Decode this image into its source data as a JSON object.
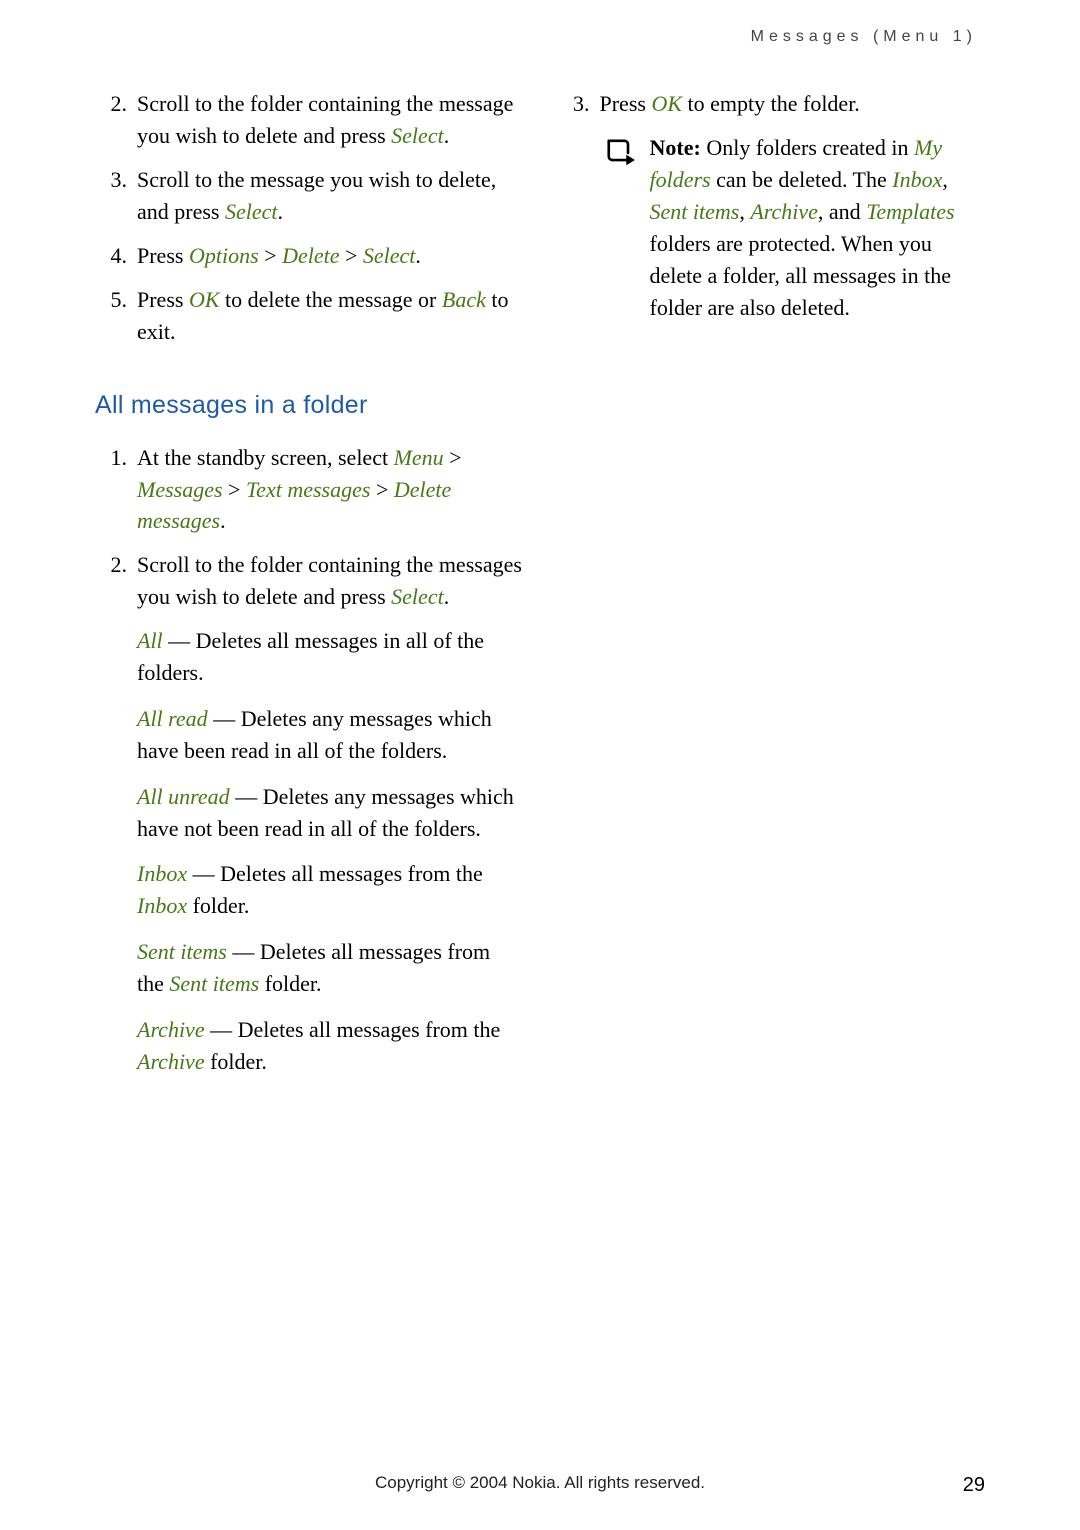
{
  "header": "Messages (Menu 1)",
  "left": {
    "topList": [
      {
        "n": "2.",
        "parts": [
          "Scroll to the folder containing the message you wish to delete and press ",
          {
            "g": "Select"
          },
          "."
        ]
      },
      {
        "n": "3.",
        "parts": [
          "Scroll to the message you wish to delete, and press ",
          {
            "g": "Select"
          },
          "."
        ]
      },
      {
        "n": "4.",
        "parts": [
          "Press ",
          {
            "g": "Options"
          },
          " > ",
          {
            "g": "Delete"
          },
          " > ",
          {
            "g": "Select"
          },
          "."
        ]
      },
      {
        "n": "5.",
        "parts": [
          "Press ",
          {
            "g": "OK"
          },
          " to delete the message or ",
          {
            "g": "Back"
          },
          " to exit."
        ]
      }
    ],
    "sectionTitle": "All messages in a folder",
    "secList": [
      {
        "n": "1.",
        "parts": [
          "At the standby screen, select ",
          {
            "g": "Menu"
          },
          " > ",
          {
            "g": "Messages"
          },
          " > ",
          {
            "g": "Text messages"
          },
          " > ",
          {
            "g": "Delete messages"
          },
          "."
        ]
      },
      {
        "n": "2.",
        "parts": [
          "Scroll to the folder containing the messages you wish to delete and press ",
          {
            "g": "Select"
          },
          "."
        ]
      }
    ],
    "subs": [
      {
        "parts": [
          {
            "g": "All"
          },
          " — Deletes all messages in all of the folders."
        ]
      },
      {
        "parts": [
          {
            "g": "All read"
          },
          " — Deletes any messages which have been read in all of the folders."
        ]
      },
      {
        "parts": [
          {
            "g": "All unread"
          },
          " — Deletes any messages which have not been read in all of the folders."
        ]
      },
      {
        "parts": [
          {
            "g": "Inbox"
          },
          " — Deletes all messages from the ",
          {
            "g": "Inbox"
          },
          " folder."
        ]
      },
      {
        "parts": [
          {
            "g": "Sent items"
          },
          " — Deletes all messages from the ",
          {
            "g": "Sent items"
          },
          " folder."
        ]
      },
      {
        "parts": [
          {
            "g": "Archive"
          },
          " — Deletes all messages from the ",
          {
            "g": "Archive"
          },
          " folder."
        ]
      }
    ]
  },
  "right": {
    "list": [
      {
        "n": "3.",
        "parts": [
          "Press ",
          {
            "g": "OK"
          },
          " to empty the folder."
        ]
      }
    ],
    "noteLabel": "Note:",
    "noteParts": [
      " Only folders created in ",
      {
        "g": "My folders"
      },
      " can be deleted. The ",
      {
        "g": "Inbox"
      },
      ", ",
      {
        "g": "Sent items"
      },
      ", ",
      {
        "g": "Archive"
      },
      ", and ",
      {
        "g": "Templates"
      },
      " folders are protected. When you delete a folder, all messages in the folder are also deleted."
    ]
  },
  "footer": "Copyright © 2004 Nokia. All rights reserved.",
  "pageNumber": "29"
}
